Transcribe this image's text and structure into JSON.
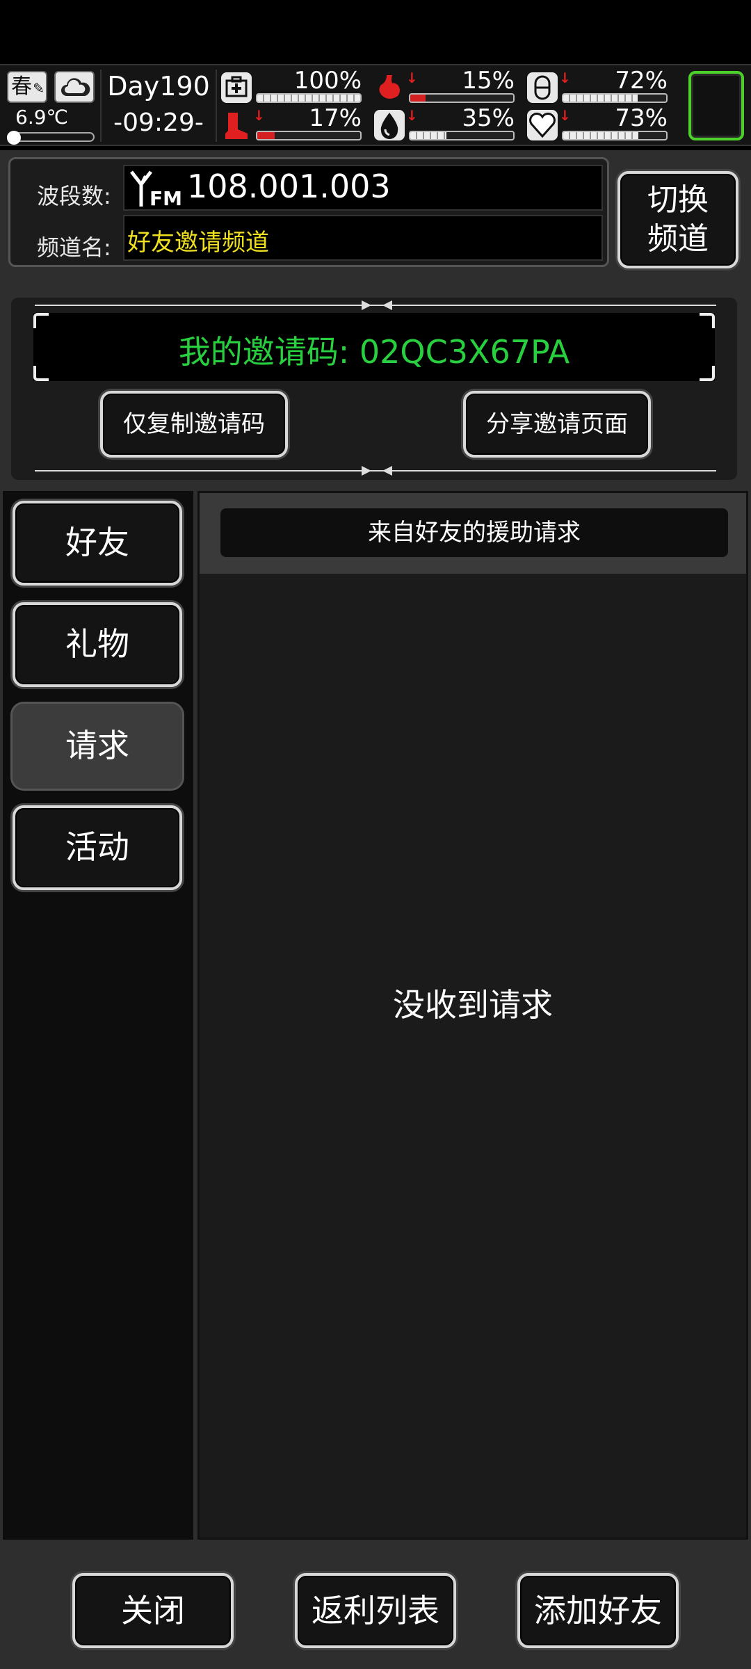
{
  "hud": {
    "season": "春",
    "weather_icon": "cloud-icon",
    "temperature": "6.9℃",
    "day": "Day190",
    "time": "-09:29-",
    "stats": [
      {
        "icon": "medkit-icon",
        "value": "100%",
        "level": 1.0,
        "warning": false,
        "color": "#e8e8e8"
      },
      {
        "icon": "stomach-icon",
        "value": "15%",
        "level": 0.15,
        "warning": true,
        "color": "#e02020"
      },
      {
        "icon": "pill-icon",
        "value": "72%",
        "level": 0.72,
        "warning": true,
        "color": "#e8e8e8"
      },
      {
        "icon": "boot-icon",
        "value": "17%",
        "level": 0.17,
        "warning": true,
        "color": "#e02020"
      },
      {
        "icon": "water-drop-icon",
        "value": "35%",
        "level": 0.35,
        "warning": true,
        "color": "#e8e8e8"
      },
      {
        "icon": "heart-icon",
        "value": "73%",
        "level": 0.73,
        "warning": true,
        "color": "#e8e8e8"
      }
    ],
    "accent_color": "#4cd02a"
  },
  "radio": {
    "freq_label": "波段数:",
    "freq_value": "108.001.003",
    "channel_label": "频道名:",
    "channel_value": "好友邀请频道",
    "switch_label_1": "切换",
    "switch_label_2": "频道"
  },
  "invite": {
    "code_text": "我的邀请码: 02QC3X67PA",
    "copy_button": "仅复制邀请码",
    "share_button": "分享邀请页面"
  },
  "tabs": [
    {
      "label": "好友",
      "active": false
    },
    {
      "label": "礼物",
      "active": false
    },
    {
      "label": "请求",
      "active": true
    },
    {
      "label": "活动",
      "active": false
    }
  ],
  "content": {
    "title": "来自好友的援助请求",
    "empty_text": "没收到请求"
  },
  "bottom": {
    "close_button": "关闭",
    "rebate_button": "返利列表",
    "add_friend_button": "添加好友"
  }
}
